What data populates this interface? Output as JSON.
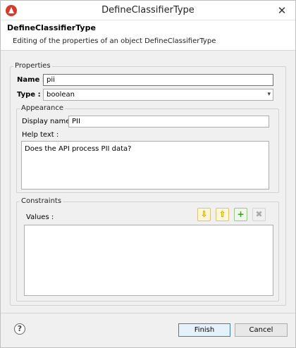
{
  "window": {
    "title": "DefineClassifierType",
    "close_glyph": "✕",
    "icon": "app-logo-icon"
  },
  "header": {
    "title": "DefineClassifierType",
    "description": "Editing of the properties of an object DefineClassifierType"
  },
  "properties": {
    "group_label": "Properties",
    "name_label": "Name :",
    "name_value": "pii",
    "type_label": "Type :",
    "type_value": "boolean"
  },
  "appearance": {
    "group_label": "Appearance",
    "display_name_label": "Display name :",
    "display_name_value": "PII",
    "help_text_label": "Help text :",
    "help_text_value": "Does the API process PII data?"
  },
  "constraints": {
    "group_label": "Constraints",
    "values_label": "Values :",
    "values": [],
    "toolbar": {
      "move_down_icon": "⇩",
      "move_up_icon": "⇧",
      "add_icon": "+",
      "remove_icon": "✖"
    }
  },
  "footer": {
    "help_glyph": "?",
    "finish_label": "Finish",
    "cancel_label": "Cancel"
  }
}
